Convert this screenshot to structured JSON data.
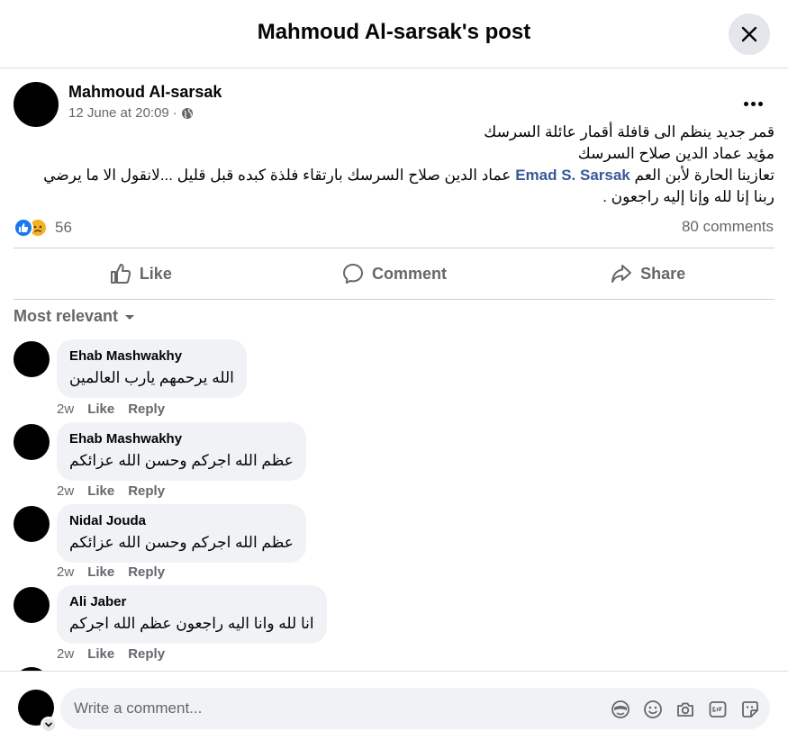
{
  "header": {
    "title": "Mahmoud Al-sarsak's post"
  },
  "post": {
    "author": "Mahmoud Al-sarsak",
    "timestamp": "12 June at 20:09",
    "separator": "·",
    "body_line1": "قمر جديد ينظم الى قافلة أقمار عائلة السرسك",
    "body_line2": "مؤيد عماد الدين صلاح السرسك",
    "body_line3_start": "تعازينا الحارة لأبن العم",
    "mention": "Emad S. Sarsak",
    "body_line3_end": "عماد الدين صلاح السرسك بارتقاء فلذة كبده قبل قليل ...لانقول الا ما يرضي ربنا إنا لله وإنا إليه راجعون ."
  },
  "stats": {
    "reaction_count": "56",
    "comments_count": "80 comments"
  },
  "actions": {
    "like": "Like",
    "comment": "Comment",
    "share": "Share"
  },
  "sort": {
    "label": "Most relevant"
  },
  "comments": [
    {
      "name": "Ehab Mashwakhy",
      "text": "الله يرحمهم يارب العالمين",
      "time": "2w",
      "like": "Like",
      "reply": "Reply"
    },
    {
      "name": "Ehab Mashwakhy",
      "text": "عظم الله اجركم وحسن الله عزائكم",
      "time": "2w",
      "like": "Like",
      "reply": "Reply"
    },
    {
      "name": "Nidal Jouda",
      "text": "عظم الله اجركم وحسن الله عزائكم",
      "time": "2w",
      "like": "Like",
      "reply": "Reply"
    },
    {
      "name": "Ali Jaber",
      "text": "انا لله وانا اليه راجعون عظم الله اجركم",
      "time": "2w",
      "like": "Like",
      "reply": "Reply"
    }
  ],
  "composer": {
    "placeholder": "Write a comment..."
  },
  "icons": {
    "close": "close-icon",
    "globe": "globe-icon",
    "more": "more-options-icon",
    "like_reaction": "like-reaction-icon",
    "sad_reaction": "sad-reaction-icon",
    "like": "thumbs-up-icon",
    "comment": "comment-bubble-icon",
    "share": "share-arrow-icon",
    "sort": "caret-down-icon",
    "avatar_sticker": "avatar-sticker-icon",
    "emoji": "emoji-icon",
    "camera": "camera-icon",
    "gif": "gif-icon",
    "sticker": "sticker-icon"
  },
  "colors": {
    "link": "#385898",
    "like_blue": "#1877f2",
    "sad_yellow": "#f7b125",
    "secondary_text": "#65676b",
    "bubble_bg": "#f0f2f5"
  }
}
